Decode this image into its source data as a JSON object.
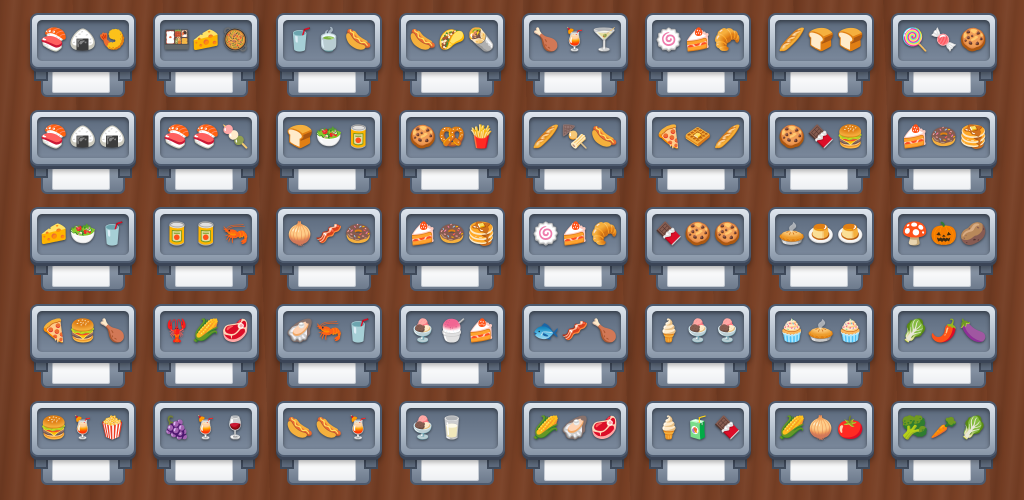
{
  "board": {
    "shelves": [
      {
        "items": [
          "🍣",
          "🍙",
          "🍤"
        ]
      },
      {
        "items": [
          "🍱",
          "🧀",
          "🥘"
        ]
      },
      {
        "items": [
          "🥤",
          "🍵",
          "🌭"
        ]
      },
      {
        "items": [
          "🌭",
          "🌮",
          "🌯"
        ]
      },
      {
        "items": [
          "🍗",
          "🍹",
          "🍸"
        ]
      },
      {
        "items": [
          "🍥",
          "🍰",
          "🥐"
        ]
      },
      {
        "items": [
          "🥖",
          "🍞",
          "🍞"
        ]
      },
      {
        "items": [
          "🍭",
          "🍬",
          "🍪"
        ]
      },
      {
        "items": [
          "🍣",
          "🍙",
          "🍙"
        ]
      },
      {
        "items": [
          "🍣",
          "🍣",
          "🍡"
        ]
      },
      {
        "items": [
          "🍞",
          "🥗",
          "🥫"
        ]
      },
      {
        "items": [
          "🍪",
          "🥨",
          "🍟"
        ]
      },
      {
        "items": [
          "🥖",
          "🍢",
          "🌭"
        ]
      },
      {
        "items": [
          "🍕",
          "🧇",
          "🥖"
        ]
      },
      {
        "items": [
          "🍪",
          "🍫",
          "🍔"
        ]
      },
      {
        "items": [
          "🍰",
          "🍩",
          "🥞"
        ]
      },
      {
        "items": [
          "🧀",
          "🥗",
          "🥤"
        ]
      },
      {
        "items": [
          "🥫",
          "🥫",
          "🦐"
        ]
      },
      {
        "items": [
          "🧅",
          "🥓",
          "🍩"
        ]
      },
      {
        "items": [
          "🍰",
          "🍩",
          "🥞"
        ]
      },
      {
        "items": [
          "🍥",
          "🍰",
          "🥐"
        ]
      },
      {
        "items": [
          "🍫",
          "🍪",
          "🍪"
        ]
      },
      {
        "items": [
          "🥧",
          "🍮",
          "🍮"
        ]
      },
      {
        "items": [
          "🍄",
          "🎃",
          "🥔"
        ]
      },
      {
        "items": [
          "🍕",
          "🍔",
          "🍗"
        ]
      },
      {
        "items": [
          "🦞",
          "🌽",
          "🥩"
        ]
      },
      {
        "items": [
          "🦪",
          "🦐",
          "🥤"
        ]
      },
      {
        "items": [
          "🍨",
          "🍧",
          "🍰"
        ]
      },
      {
        "items": [
          "🐟",
          "🥓",
          "🍗"
        ]
      },
      {
        "items": [
          "🍦",
          "🍨",
          "🍨"
        ]
      },
      {
        "items": [
          "🧁",
          "🥧",
          "🧁"
        ]
      },
      {
        "items": [
          "🥬",
          "🌶️",
          "🍆"
        ]
      },
      {
        "items": [
          "🍔",
          "🍹",
          "🍿"
        ]
      },
      {
        "items": [
          "🍇",
          "🍹",
          "🍷"
        ]
      },
      {
        "items": [
          "🌭",
          "🌭",
          "🍹"
        ]
      },
      {
        "items": [
          "🍨",
          "🥛",
          ""
        ]
      },
      {
        "items": [
          "🌽",
          "🦪",
          "🥩"
        ]
      },
      {
        "items": [
          "🍦",
          "🧃",
          "🍫"
        ]
      },
      {
        "items": [
          "🌽",
          "🧅",
          "🍅"
        ]
      },
      {
        "items": [
          "🥦",
          "🥕",
          "🥬"
        ]
      }
    ]
  }
}
